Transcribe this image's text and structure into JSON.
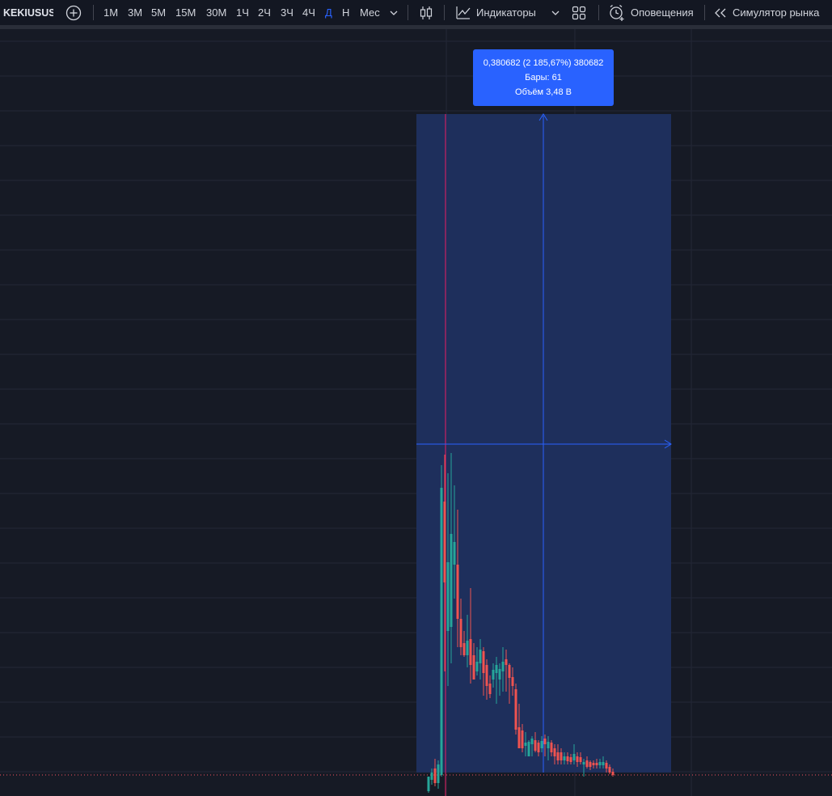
{
  "toolbar": {
    "symbol": "KEKIUSUS",
    "timeframes": [
      "1М",
      "3М",
      "5М",
      "15М",
      "30М",
      "1Ч",
      "2Ч",
      "3Ч",
      "4Ч",
      "Д",
      "Н",
      "Мес"
    ],
    "active_timeframe": "Д",
    "indicators_label": "Индикаторы",
    "alerts_label": "Оповещения",
    "replay_label": "Симулятор рынка"
  },
  "measure_tooltip": {
    "line1": "0,380682 (2 185,67%) 380682",
    "line2": "Бары: 61",
    "line3": "Объём 3,48 B"
  },
  "colors": {
    "background": "#161a25",
    "grid": "#242836",
    "up": "#26a69a",
    "down": "#ef5350",
    "measure_fill": "#1e2f5c",
    "measure_accent": "#2962ff",
    "price_line": "#f7525f",
    "crosshair_line": "#e91e63"
  },
  "chart_data": {
    "type": "candlestick",
    "bars": 61
  }
}
